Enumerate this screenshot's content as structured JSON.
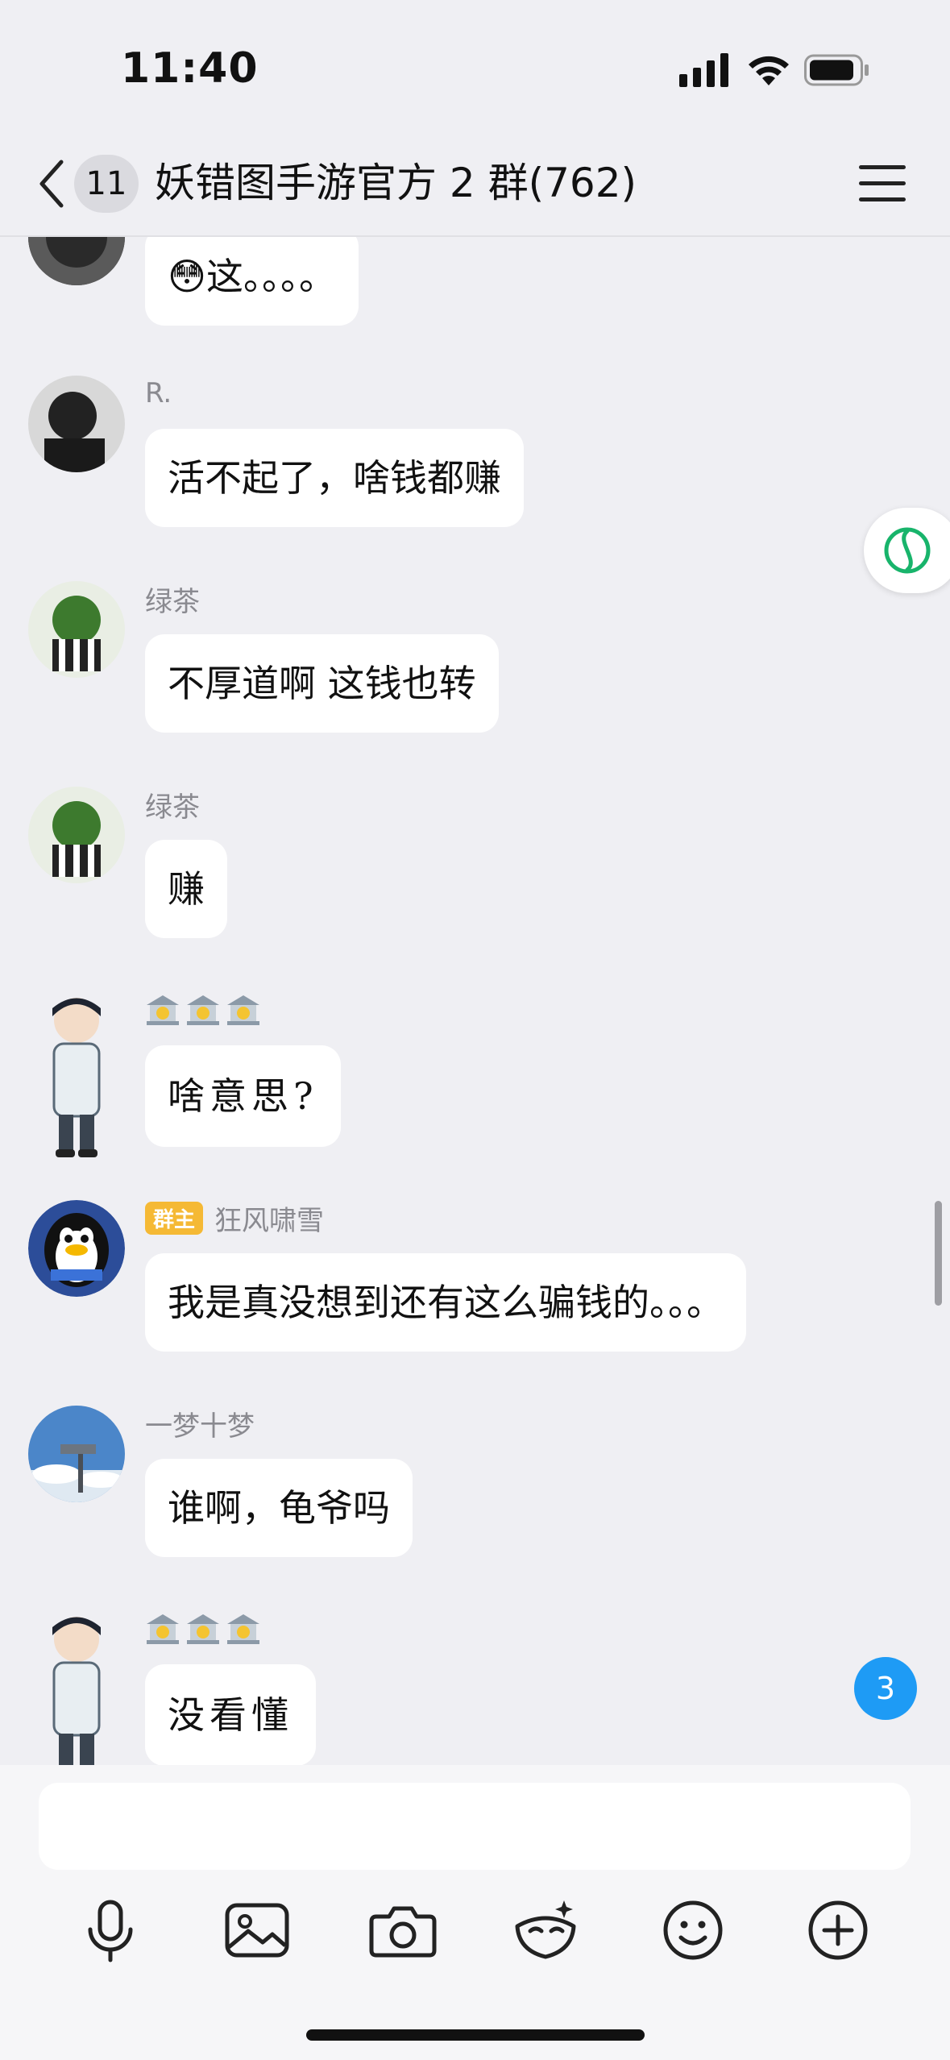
{
  "status_bar": {
    "time": "11:40"
  },
  "header": {
    "back_count": "11",
    "title": "妖错图手游官方 2 群(762)"
  },
  "messages": [
    {
      "sender": "",
      "text": "这。。。。",
      "emoji": "😳"
    },
    {
      "sender": "R.",
      "text": "活不起了，啥钱都赚"
    },
    {
      "sender": "绿茶",
      "text": "不厚道啊 这钱也转"
    },
    {
      "sender": "绿茶",
      "text": "赚"
    },
    {
      "sender": "",
      "text": "啥意思?"
    },
    {
      "sender": "狂风啸雪",
      "owner_badge": "群主",
      "text": "我是真没想到还有这么骗钱的。。。"
    },
    {
      "sender": "一梦十梦",
      "text": "谁啊，龟爷吗"
    },
    {
      "sender": "",
      "text": "没看懂"
    }
  ],
  "new_message_count": "3",
  "input": {
    "placeholder": ""
  },
  "colors": {
    "accent": "#1E9BF5",
    "owner_badge": "#F5B935",
    "bubble": "#FFFFFF",
    "background": "#EFEFF3"
  }
}
